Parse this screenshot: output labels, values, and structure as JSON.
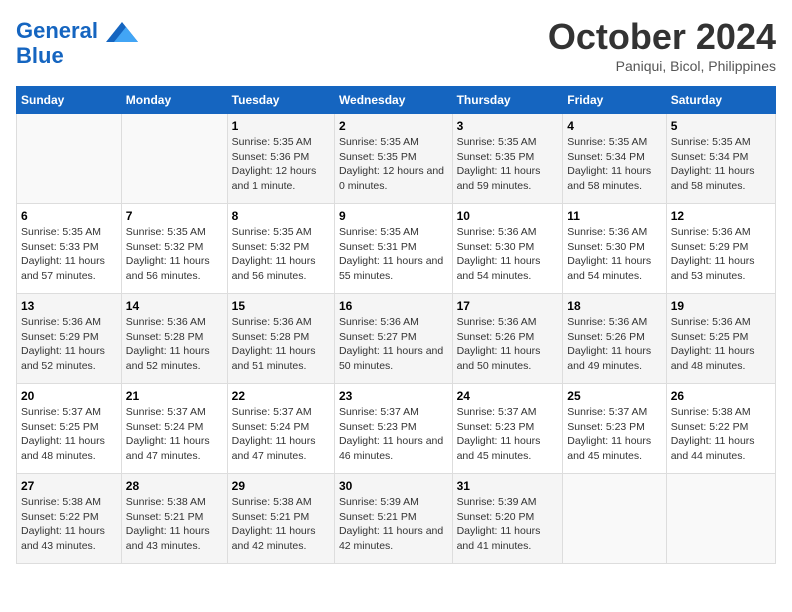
{
  "header": {
    "logo_line1": "General",
    "logo_line2": "Blue",
    "month": "October 2024",
    "location": "Paniqui, Bicol, Philippines"
  },
  "days_of_week": [
    "Sunday",
    "Monday",
    "Tuesday",
    "Wednesday",
    "Thursday",
    "Friday",
    "Saturday"
  ],
  "weeks": [
    [
      {
        "day": "",
        "data": ""
      },
      {
        "day": "",
        "data": ""
      },
      {
        "day": "1",
        "data": "Sunrise: 5:35 AM\nSunset: 5:36 PM\nDaylight: 12 hours and 1 minute."
      },
      {
        "day": "2",
        "data": "Sunrise: 5:35 AM\nSunset: 5:35 PM\nDaylight: 12 hours and 0 minutes."
      },
      {
        "day": "3",
        "data": "Sunrise: 5:35 AM\nSunset: 5:35 PM\nDaylight: 11 hours and 59 minutes."
      },
      {
        "day": "4",
        "data": "Sunrise: 5:35 AM\nSunset: 5:34 PM\nDaylight: 11 hours and 58 minutes."
      },
      {
        "day": "5",
        "data": "Sunrise: 5:35 AM\nSunset: 5:34 PM\nDaylight: 11 hours and 58 minutes."
      }
    ],
    [
      {
        "day": "6",
        "data": "Sunrise: 5:35 AM\nSunset: 5:33 PM\nDaylight: 11 hours and 57 minutes."
      },
      {
        "day": "7",
        "data": "Sunrise: 5:35 AM\nSunset: 5:32 PM\nDaylight: 11 hours and 56 minutes."
      },
      {
        "day": "8",
        "data": "Sunrise: 5:35 AM\nSunset: 5:32 PM\nDaylight: 11 hours and 56 minutes."
      },
      {
        "day": "9",
        "data": "Sunrise: 5:35 AM\nSunset: 5:31 PM\nDaylight: 11 hours and 55 minutes."
      },
      {
        "day": "10",
        "data": "Sunrise: 5:36 AM\nSunset: 5:30 PM\nDaylight: 11 hours and 54 minutes."
      },
      {
        "day": "11",
        "data": "Sunrise: 5:36 AM\nSunset: 5:30 PM\nDaylight: 11 hours and 54 minutes."
      },
      {
        "day": "12",
        "data": "Sunrise: 5:36 AM\nSunset: 5:29 PM\nDaylight: 11 hours and 53 minutes."
      }
    ],
    [
      {
        "day": "13",
        "data": "Sunrise: 5:36 AM\nSunset: 5:29 PM\nDaylight: 11 hours and 52 minutes."
      },
      {
        "day": "14",
        "data": "Sunrise: 5:36 AM\nSunset: 5:28 PM\nDaylight: 11 hours and 52 minutes."
      },
      {
        "day": "15",
        "data": "Sunrise: 5:36 AM\nSunset: 5:28 PM\nDaylight: 11 hours and 51 minutes."
      },
      {
        "day": "16",
        "data": "Sunrise: 5:36 AM\nSunset: 5:27 PM\nDaylight: 11 hours and 50 minutes."
      },
      {
        "day": "17",
        "data": "Sunrise: 5:36 AM\nSunset: 5:26 PM\nDaylight: 11 hours and 50 minutes."
      },
      {
        "day": "18",
        "data": "Sunrise: 5:36 AM\nSunset: 5:26 PM\nDaylight: 11 hours and 49 minutes."
      },
      {
        "day": "19",
        "data": "Sunrise: 5:36 AM\nSunset: 5:25 PM\nDaylight: 11 hours and 48 minutes."
      }
    ],
    [
      {
        "day": "20",
        "data": "Sunrise: 5:37 AM\nSunset: 5:25 PM\nDaylight: 11 hours and 48 minutes."
      },
      {
        "day": "21",
        "data": "Sunrise: 5:37 AM\nSunset: 5:24 PM\nDaylight: 11 hours and 47 minutes."
      },
      {
        "day": "22",
        "data": "Sunrise: 5:37 AM\nSunset: 5:24 PM\nDaylight: 11 hours and 47 minutes."
      },
      {
        "day": "23",
        "data": "Sunrise: 5:37 AM\nSunset: 5:23 PM\nDaylight: 11 hours and 46 minutes."
      },
      {
        "day": "24",
        "data": "Sunrise: 5:37 AM\nSunset: 5:23 PM\nDaylight: 11 hours and 45 minutes."
      },
      {
        "day": "25",
        "data": "Sunrise: 5:37 AM\nSunset: 5:23 PM\nDaylight: 11 hours and 45 minutes."
      },
      {
        "day": "26",
        "data": "Sunrise: 5:38 AM\nSunset: 5:22 PM\nDaylight: 11 hours and 44 minutes."
      }
    ],
    [
      {
        "day": "27",
        "data": "Sunrise: 5:38 AM\nSunset: 5:22 PM\nDaylight: 11 hours and 43 minutes."
      },
      {
        "day": "28",
        "data": "Sunrise: 5:38 AM\nSunset: 5:21 PM\nDaylight: 11 hours and 43 minutes."
      },
      {
        "day": "29",
        "data": "Sunrise: 5:38 AM\nSunset: 5:21 PM\nDaylight: 11 hours and 42 minutes."
      },
      {
        "day": "30",
        "data": "Sunrise: 5:39 AM\nSunset: 5:21 PM\nDaylight: 11 hours and 42 minutes."
      },
      {
        "day": "31",
        "data": "Sunrise: 5:39 AM\nSunset: 5:20 PM\nDaylight: 11 hours and 41 minutes."
      },
      {
        "day": "",
        "data": ""
      },
      {
        "day": "",
        "data": ""
      }
    ]
  ]
}
